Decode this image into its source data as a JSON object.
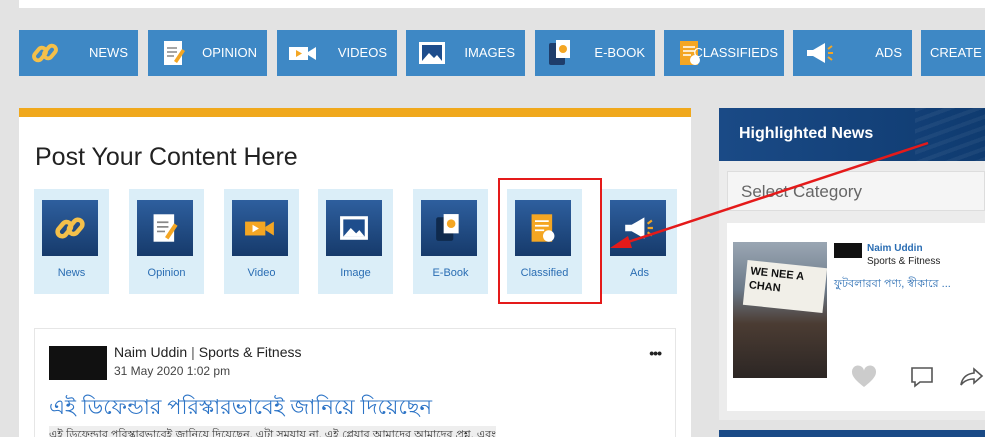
{
  "nav": {
    "items": [
      {
        "label": "NEWS",
        "icon": "link-icon"
      },
      {
        "label": "OPINION",
        "icon": "pencil-doc-icon"
      },
      {
        "label": "VIDEOS",
        "icon": "video-camera-icon"
      },
      {
        "label": "IMAGES",
        "icon": "image-icon"
      },
      {
        "label": "E-BOOK",
        "icon": "ebook-icon"
      },
      {
        "label": "CLASSIFIEDS",
        "icon": "classified-icon"
      },
      {
        "label": "ADS",
        "icon": "megaphone-icon"
      },
      {
        "label": "CREATE F",
        "icon": ""
      }
    ]
  },
  "post": {
    "title": "Post Your Content Here",
    "tiles": [
      {
        "label": "News"
      },
      {
        "label": "Opinion"
      },
      {
        "label": "Video"
      },
      {
        "label": "Image"
      },
      {
        "label": "E-Book"
      },
      {
        "label": "Classified"
      },
      {
        "label": "Ads"
      }
    ]
  },
  "feed": {
    "author": "Naim Uddin",
    "category": "Sports & Fitness",
    "date": "31 May 2020 1:02 pm",
    "title": "এই ডিফেন্ডার পরিস্কারভাবেই জানিয়ে দিয়েছেন",
    "excerpt": "এই ডিফেন্ডার পরিস্কারভাবেই জানিয়ে দিয়েছেন, এটা সময়ায় না, এই প্লেয়ার আমাদের আমাদের প্রশ্ন, এবং"
  },
  "sidebar": {
    "title": "Highlighted News",
    "select_placeholder": "Select Category",
    "card": {
      "author": "Naim Uddin",
      "category": "Sports & Fitness",
      "title": "ফুটবলারবা পণ্য, স্বীকারে ...",
      "sign_text": "WE NEE A CHAN"
    }
  },
  "colors": {
    "nav_bg": "#3e88c5",
    "accent_orange": "#f0a81c",
    "highlight_red": "#e41a1a",
    "sidebar_header": "#1a4a86"
  }
}
